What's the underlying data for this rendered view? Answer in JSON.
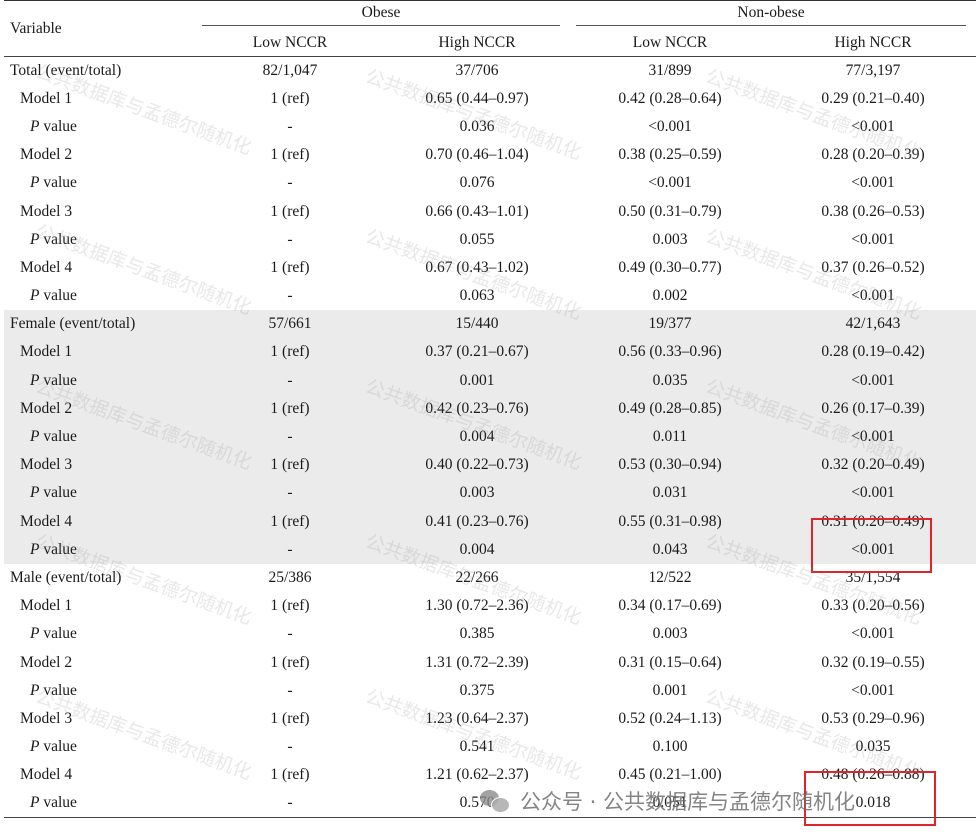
{
  "header": {
    "variable": "Variable",
    "group_obese": "Obese",
    "group_nonobese": "Non-obese",
    "low": "Low NCCR",
    "high": "High NCCR"
  },
  "rows": [
    {
      "label": "Total (event/total)",
      "kind": "group",
      "shade": false,
      "vals": [
        "82/1,047",
        "37/706",
        "31/899",
        "77/3,197"
      ]
    },
    {
      "label": "Model 1",
      "kind": "model",
      "shade": false,
      "vals": [
        "1 (ref)",
        "0.65 (0.44–0.97)",
        "0.42 (0.28–0.64)",
        "0.29 (0.21–0.40)"
      ]
    },
    {
      "label": "P",
      "suffix": " value",
      "kind": "p",
      "shade": false,
      "vals": [
        "-",
        "0.036",
        "<0.001",
        "<0.001"
      ]
    },
    {
      "label": "Model 2",
      "kind": "model",
      "shade": false,
      "vals": [
        "1 (ref)",
        "0.70 (0.46–1.04)",
        "0.38 (0.25–0.59)",
        "0.28 (0.20–0.39)"
      ]
    },
    {
      "label": "P",
      "suffix": " value",
      "kind": "p",
      "shade": false,
      "vals": [
        "-",
        "0.076",
        "<0.001",
        "<0.001"
      ]
    },
    {
      "label": "Model 3",
      "kind": "model",
      "shade": false,
      "vals": [
        "1 (ref)",
        "0.66 (0.43–1.01)",
        "0.50 (0.31–0.79)",
        "0.38 (0.26–0.53)"
      ]
    },
    {
      "label": "P",
      "suffix": " value",
      "kind": "p",
      "shade": false,
      "vals": [
        "-",
        "0.055",
        "0.003",
        "<0.001"
      ]
    },
    {
      "label": "Model 4",
      "kind": "model",
      "shade": false,
      "vals": [
        "1 (ref)",
        "0.67 (0.43–1.02)",
        "0.49 (0.30–0.77)",
        "0.37 (0.26–0.52)"
      ]
    },
    {
      "label": "P",
      "suffix": " value",
      "kind": "p",
      "shade": false,
      "vals": [
        "-",
        "0.063",
        "0.002",
        "<0.001"
      ]
    },
    {
      "label": "Female (event/total)",
      "kind": "group",
      "shade": true,
      "vals": [
        "57/661",
        "15/440",
        "19/377",
        "42/1,643"
      ]
    },
    {
      "label": "Model 1",
      "kind": "model",
      "shade": true,
      "vals": [
        "1 (ref)",
        "0.37 (0.21–0.67)",
        "0.56 (0.33–0.96)",
        "0.28 (0.19–0.42)"
      ]
    },
    {
      "label": "P",
      "suffix": " value",
      "kind": "p",
      "shade": true,
      "vals": [
        "-",
        "0.001",
        "0.035",
        "<0.001"
      ]
    },
    {
      "label": "Model 2",
      "kind": "model",
      "shade": true,
      "vals": [
        "1 (ref)",
        "0.42 (0.23–0.76)",
        "0.49 (0.28–0.85)",
        "0.26 (0.17–0.39)"
      ]
    },
    {
      "label": "P",
      "suffix": " value",
      "kind": "p",
      "shade": true,
      "vals": [
        "-",
        "0.004",
        "0.011",
        "<0.001"
      ]
    },
    {
      "label": "Model 3",
      "kind": "model",
      "shade": true,
      "vals": [
        "1 (ref)",
        "0.40 (0.22–0.73)",
        "0.53 (0.30–0.94)",
        "0.32 (0.20–0.49)"
      ]
    },
    {
      "label": "P",
      "suffix": " value",
      "kind": "p",
      "shade": true,
      "vals": [
        "-",
        "0.003",
        "0.031",
        "<0.001"
      ]
    },
    {
      "label": "Model 4",
      "kind": "model",
      "shade": true,
      "vals": [
        "1 (ref)",
        "0.41 (0.23–0.76)",
        "0.55 (0.31–0.98)",
        "0.31 (0.20–0.49)"
      ]
    },
    {
      "label": "P",
      "suffix": " value",
      "kind": "p",
      "shade": true,
      "vals": [
        "-",
        "0.004",
        "0.043",
        "<0.001"
      ]
    },
    {
      "label": "Male (event/total)",
      "kind": "group",
      "shade": false,
      "vals": [
        "25/386",
        "22/266",
        "12/522",
        "35/1,554"
      ]
    },
    {
      "label": "Model 1",
      "kind": "model",
      "shade": false,
      "vals": [
        "1 (ref)",
        "1.30 (0.72–2.36)",
        "0.34 (0.17–0.69)",
        "0.33 (0.20–0.56)"
      ]
    },
    {
      "label": "P",
      "suffix": " value",
      "kind": "p",
      "shade": false,
      "vals": [
        "-",
        "0.385",
        "0.003",
        "<0.001"
      ]
    },
    {
      "label": "Model 2",
      "kind": "model",
      "shade": false,
      "vals": [
        "1 (ref)",
        "1.31 (0.72–2.39)",
        "0.31 (0.15–0.64)",
        "0.32 (0.19–0.55)"
      ]
    },
    {
      "label": "P",
      "suffix": " value",
      "kind": "p",
      "shade": false,
      "vals": [
        "-",
        "0.375",
        "0.001",
        "<0.001"
      ]
    },
    {
      "label": "Model 3",
      "kind": "model",
      "shade": false,
      "vals": [
        "1 (ref)",
        "1.23 (0.64–2.37)",
        "0.52 (0.24–1.13)",
        "0.53 (0.29–0.96)"
      ]
    },
    {
      "label": "P",
      "suffix": " value",
      "kind": "p",
      "shade": false,
      "vals": [
        "-",
        "0.541",
        "0.100",
        "0.035"
      ]
    },
    {
      "label": "Model 4",
      "kind": "model",
      "shade": false,
      "vals": [
        "1 (ref)",
        "1.21 (0.62–2.37)",
        "0.45 (0.21–1.00)",
        "0.48 (0.26–0.88)"
      ]
    },
    {
      "label": "P",
      "suffix": " value",
      "kind": "p",
      "shade": false,
      "vals": [
        "-",
        "0.570",
        "0.051",
        "0.018"
      ]
    }
  ],
  "watermark_text": "公共数据库与孟德尔随机化",
  "footer_watermark": "公众号 · 公共数据库与孟德尔随机化",
  "colors": {
    "highlight": "#e0242b",
    "shade": "#ebebeb"
  }
}
